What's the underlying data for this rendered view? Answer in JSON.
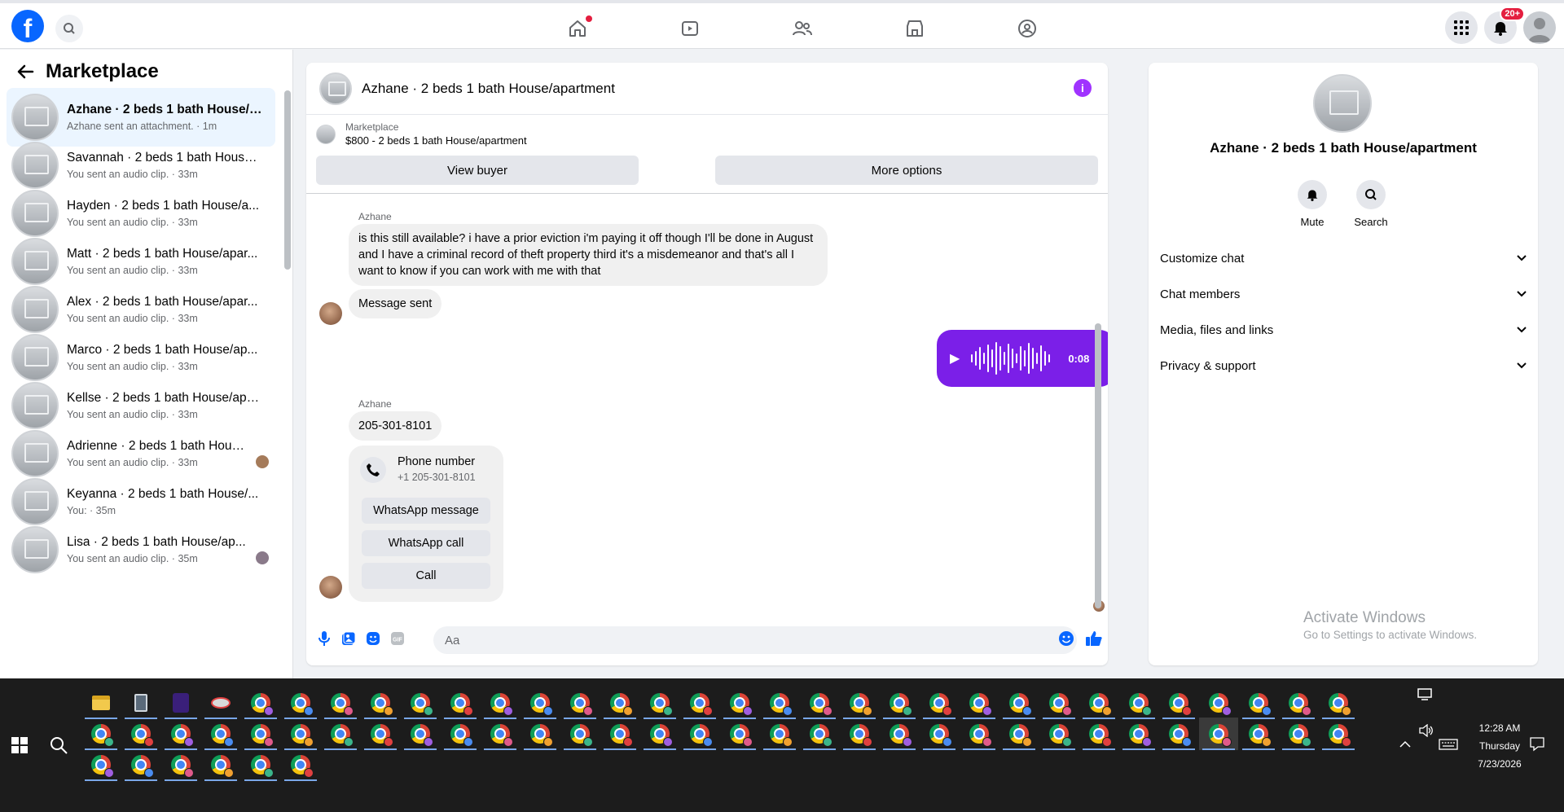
{
  "topbar": {
    "logo": "f",
    "notifications_badge": "20+",
    "nav_icons": [
      "home-icon",
      "watch-icon",
      "friends-icon",
      "marketplace-icon",
      "groups-icon"
    ]
  },
  "sidebar": {
    "title": "Marketplace",
    "conversations": [
      {
        "name": "Azhane · 2 beds 1 bath House/a...",
        "sub": "Azhane sent an attachment. · 1m",
        "active": true
      },
      {
        "name": "Savannah · 2 beds 1 bath House/...",
        "sub": "You sent an audio clip. · 33m"
      },
      {
        "name": "Hayden · 2 beds 1 bath House/a...",
        "sub": "You sent an audio clip. · 33m"
      },
      {
        "name": "Matt · 2 beds 1 bath House/apar...",
        "sub": "You sent an audio clip. · 33m"
      },
      {
        "name": "Alex · 2 beds 1 bath House/apar...",
        "sub": "You sent an audio clip. · 33m"
      },
      {
        "name": "Marco · 2 beds 1 bath House/ap...",
        "sub": "You sent an audio clip. · 33m"
      },
      {
        "name": "Kellse · 2 beds 1 bath House/apa...",
        "sub": "You sent an audio clip. · 33m"
      },
      {
        "name": "Adrienne · 2 beds 1 bath Hous...",
        "sub": "You sent an audio clip. · 33m"
      },
      {
        "name": "Keyanna · 2 beds 1 bath House/...",
        "sub": "You: · 35m"
      },
      {
        "name": "Lisa · 2 beds 1 bath House/ap...",
        "sub": "You sent an audio clip. · 35m"
      }
    ]
  },
  "chat": {
    "title": "Azhane · 2 beds 1 bath House/apartment",
    "marketplace_label": "Marketplace",
    "listing": "$800 - 2 beds 1 bath House/apartment",
    "view_buyer": "View buyer",
    "more_options": "More options",
    "sender1": "Azhane",
    "msg1": "is this still available? i have a prior eviction i'm paying it off though I'll be done in August and I have a criminal record of theft property third it's a misdemeanor and that's all I want to know if you can work with me with that",
    "msg2": "Message sent",
    "audio_duration": "0:08",
    "sender2": "Azhane",
    "msg3": "205-301-8101",
    "phone_title": "Phone number",
    "phone_number": "+1 205-301-8101",
    "whatsapp_message": "WhatsApp message",
    "whatsapp_call": "WhatsApp call",
    "call": "Call",
    "input_placeholder": "Aa"
  },
  "details": {
    "title": "Azhane · 2 beds 1 bath House/apartment",
    "mute": "Mute",
    "search": "Search",
    "rows": [
      "Customize chat",
      "Chat members",
      "Media, files and links",
      "Privacy & support"
    ],
    "activate_title": "Activate Windows",
    "activate_sub": "Go to Settings to activate Windows."
  },
  "taskbar": {
    "time": "12:28 AM",
    "day": "Thursday",
    "date": "7/23/2026"
  },
  "colors": {
    "fb_blue": "#0866ff",
    "audio_purple": "#7b1fe8",
    "info_purple": "#a033ff",
    "badge_red": "#e41e3f"
  }
}
